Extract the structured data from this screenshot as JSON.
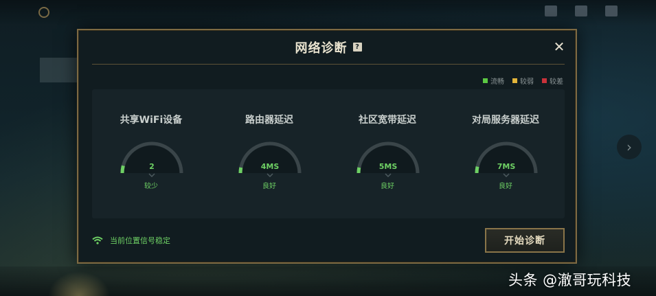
{
  "dialog": {
    "title": "网络诊断",
    "help_icon": "question-mark-icon",
    "close_icon": "close-icon"
  },
  "legend": [
    {
      "label": "流畅",
      "color": "#5cc843"
    },
    {
      "label": "较弱",
      "color": "#e2b43a"
    },
    {
      "label": "较差",
      "color": "#c8323a"
    }
  ],
  "metrics": [
    {
      "label": "共享WiFi设备",
      "value": "2",
      "status": "较少",
      "level": 0.08
    },
    {
      "label": "路由器延迟",
      "value": "4MS",
      "status": "良好",
      "level": 0.06
    },
    {
      "label": "社区宽带延迟",
      "value": "5MS",
      "status": "良好",
      "level": 0.06
    },
    {
      "label": "对局服务器延迟",
      "value": "7MS",
      "status": "良好",
      "level": 0.07
    }
  ],
  "signal": {
    "icon": "wifi-icon",
    "text": "当前位置信号稳定"
  },
  "start_button": "开始诊断",
  "watermark": "头条 @澈哥玩科技",
  "colors": {
    "good": "#6ed064",
    "border_gold": "#7d6a43"
  }
}
